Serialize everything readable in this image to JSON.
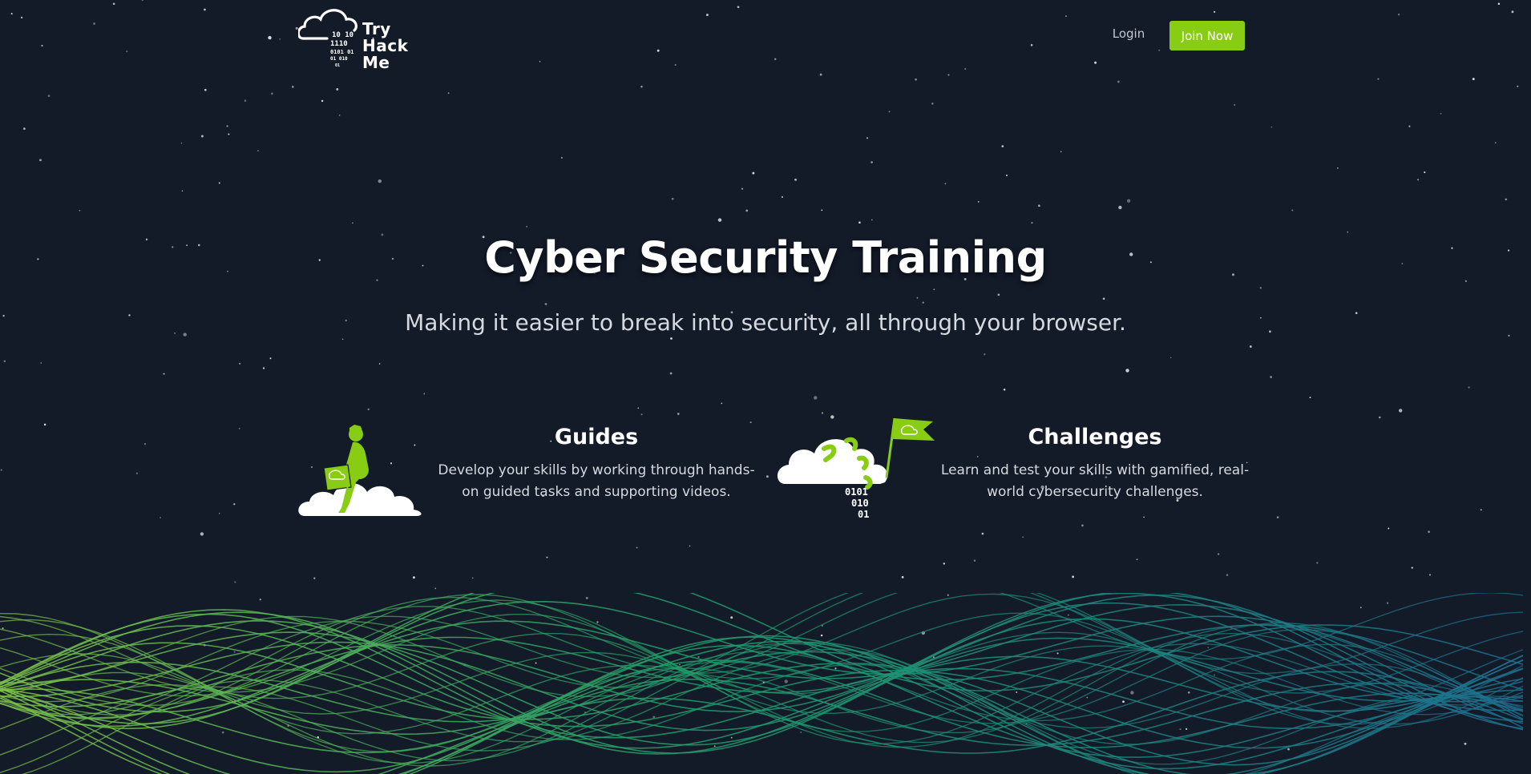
{
  "header": {
    "logo_lines": [
      "Try",
      "Hack",
      "Me"
    ],
    "logo_binary": [
      "10  10",
      "1110",
      "0101  01",
      "01  010",
      "01"
    ],
    "login_label": "Login",
    "join_label": "Join Now"
  },
  "hero": {
    "title": "Cyber Security Training",
    "subtitle": "Making it easier to break into security, all through your browser."
  },
  "features": [
    {
      "title": "Guides",
      "description": "Develop your skills by working through hands-on guided tasks and supporting videos.",
      "icon": "person-on-cloud-icon"
    },
    {
      "title": "Challenges",
      "description": "Learn and test your skills with gamified, real-world cybersecurity challenges.",
      "icon": "cloud-flag-icon",
      "binary": [
        "0101",
        "010",
        "01"
      ]
    }
  ],
  "colors": {
    "background": "#131a28",
    "accent": "#88cc14",
    "wave_green": "#1f9d6a",
    "wave_teal": "#1d6f8f"
  }
}
